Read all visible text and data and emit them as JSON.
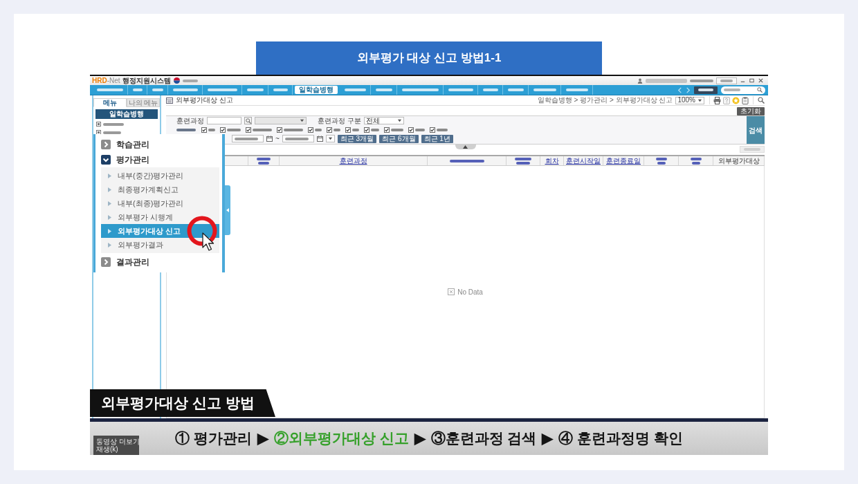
{
  "slide_title": "외부평가 대상 신고 방법1-1",
  "video": {
    "app": {
      "logo": {
        "mark": "HRD",
        "suffix": "-Net",
        "system": "행정지원시스템"
      },
      "menu_tabs": [
        {
          "selected": false
        },
        {
          "selected": false
        },
        {
          "selected": false
        },
        {
          "selected": false
        },
        {
          "selected": false
        },
        {
          "selected": false
        },
        {
          "selected": false
        },
        {
          "label": "일학습병행",
          "selected": true
        },
        {
          "selected": false
        },
        {
          "selected": false
        },
        {
          "selected": false
        },
        {
          "selected": false
        },
        {
          "selected": false
        },
        {
          "selected": false
        },
        {
          "selected": false
        },
        {
          "selected": false
        }
      ],
      "side_menu": {
        "tabs": [
          {
            "label": "메뉴",
            "selected": true
          },
          {
            "label": "나의 메뉴",
            "selected": false
          }
        ],
        "header": "일학습병행"
      },
      "page": {
        "title": "외부평가대상 신고",
        "breadcrumb": "일학습병행 > 평가관리 > 외부평가대상 신고",
        "zoom": "100%"
      },
      "search": {
        "reset_button": "초기화",
        "course_label": "훈련과정",
        "course_type_label": "훈련과정 구분",
        "course_type_value": "전체",
        "status_options": [
          {
            "checked": true
          },
          {
            "checked": true
          },
          {
            "checked": true
          },
          {
            "checked": true
          },
          {
            "checked": true
          },
          {
            "checked": true
          },
          {
            "checked": true
          },
          {
            "checked": true
          },
          {
            "checked": true
          },
          {
            "checked": true
          },
          {
            "checked": true
          }
        ],
        "range_separator": "~",
        "period_buttons": [
          "최근 3개월",
          "최근 6개월",
          "최근 1년"
        ],
        "search_button": "검색"
      },
      "table": {
        "columns": [
          {
            "link": true
          },
          {
            "label": "훈련과정",
            "link": true
          },
          {
            "link": true
          },
          {
            "link": true
          },
          {
            "label": "회차",
            "link": true
          },
          {
            "label": "훈련시작일",
            "link": true
          },
          {
            "label": "훈련종료일",
            "link": true
          },
          {
            "link": true
          },
          {
            "link": true
          },
          {
            "label": "외부평가대상",
            "link": false
          }
        ],
        "empty_text": "No Data"
      }
    },
    "callout": {
      "groups": [
        {
          "label": "학습관리",
          "expanded": false
        },
        {
          "label": "평가관리",
          "expanded": true,
          "children": [
            {
              "label": "내부(중간)평가관리",
              "selected": false
            },
            {
              "label": "최종평가계획신고",
              "selected": false
            },
            {
              "label": "내부(최종)평가관리",
              "selected": false
            },
            {
              "label": "외부평가 시행계",
              "selected": false
            },
            {
              "label": "외부평가대상 신고",
              "selected": true
            },
            {
              "label": "외부평가결과",
              "selected": false
            }
          ]
        },
        {
          "label": "결과관리",
          "expanded": false
        }
      ]
    },
    "caption_title": "외부평가대상 신고 방법",
    "steps": [
      {
        "kind": "step",
        "text": "① 평가관리",
        "highlighted": false
      },
      {
        "kind": "arrow",
        "text": "▶"
      },
      {
        "kind": "step",
        "text": "②외부평가대상 신고",
        "highlighted": true
      },
      {
        "kind": "arrow",
        "text": "▶"
      },
      {
        "kind": "step",
        "text": "③훈련과정 검색",
        "highlighted": false
      },
      {
        "kind": "arrow",
        "text": "▶"
      },
      {
        "kind": "step",
        "text": "④ 훈련과정명 확인",
        "highlighted": false
      }
    ],
    "player_tooltip": [
      "동영상 더보기",
      "재생(k)"
    ]
  }
}
